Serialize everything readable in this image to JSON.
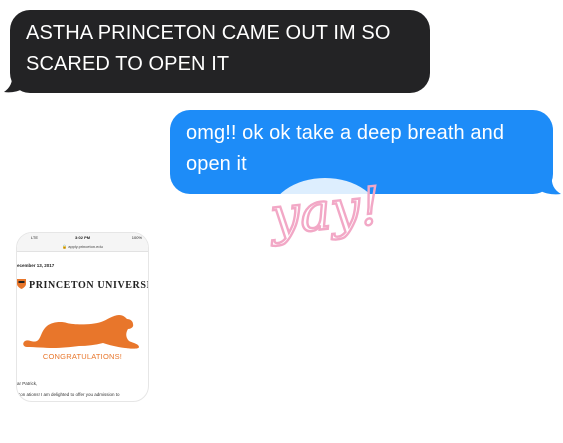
{
  "messages": [
    {
      "direction": "incoming",
      "line1": "ASTHA PRINCETON CAME OUT IM SO",
      "line2": "SCARED TO OPEN IT"
    },
    {
      "direction": "outgoing",
      "line1": "omg!! ok ok take a deep breath and",
      "line2": "open it"
    }
  ],
  "sticker": {
    "text": "yay!",
    "color": "#f2a8c6"
  },
  "attachment": {
    "status_bar": {
      "signal": "LTE",
      "time": "3:02 PM",
      "battery": "100%"
    },
    "url": "apply.princeton.edu",
    "date": "ecember 13, 2017",
    "brand": "PRINCETON UNIVERSI",
    "congrats": "CONGRATULATIONS!",
    "greeting": "ar Patrick,",
    "body": "Con    ations!  I am delighted to offer you admission to"
  },
  "colors": {
    "incoming_bubble": "#232325",
    "outgoing_bubble": "#1d8cf8",
    "princeton_orange": "#e8762b"
  }
}
